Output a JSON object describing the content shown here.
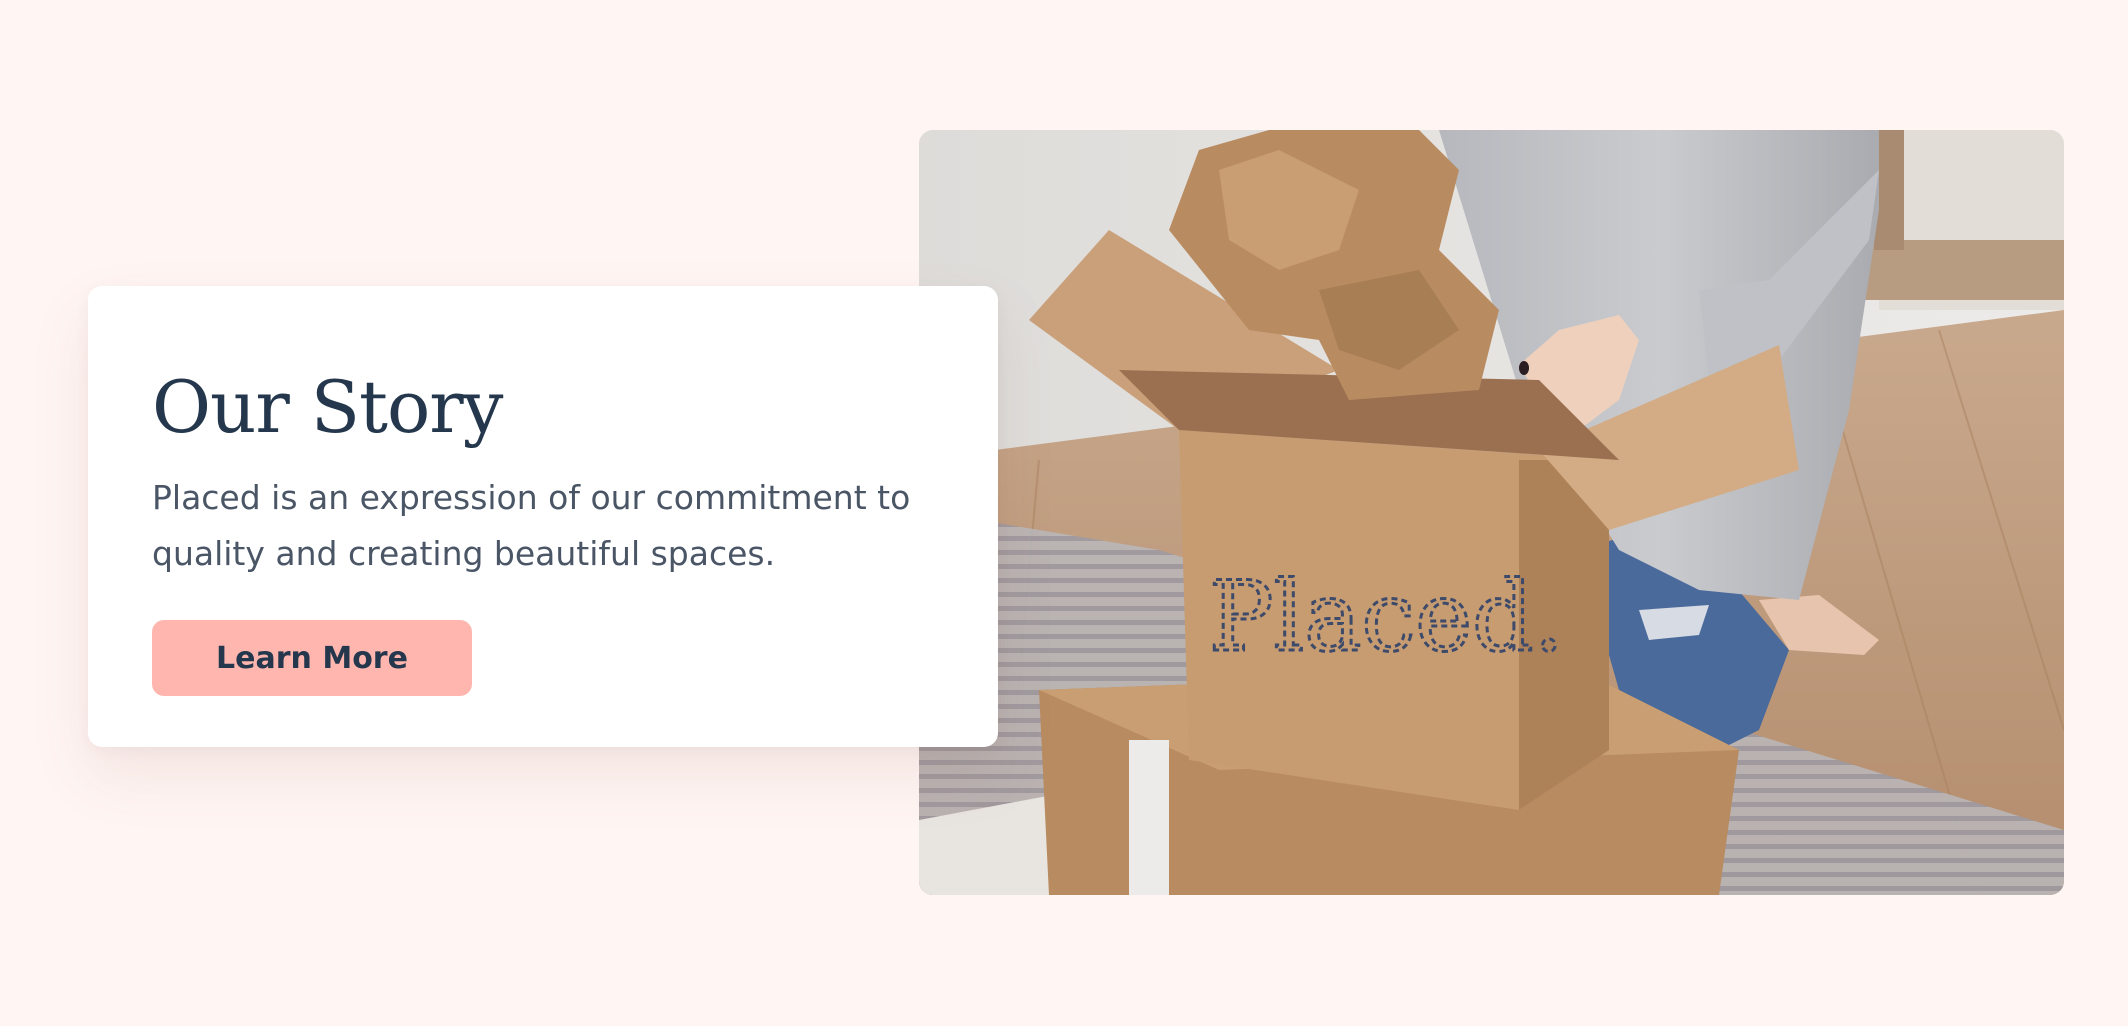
{
  "story": {
    "title": "Our Story",
    "body": "Placed is an expression of our commitment to quality and creating beautiful spaces.",
    "cta_label": "Learn More"
  },
  "photo": {
    "description_icon": "unboxing-photo",
    "box_brand_text": "Placed."
  },
  "colors": {
    "page_background": "#fff5f3",
    "title": "#24374c",
    "body_text": "#4a5566",
    "button_background": "#ffb6af",
    "button_text": "#24374c"
  }
}
